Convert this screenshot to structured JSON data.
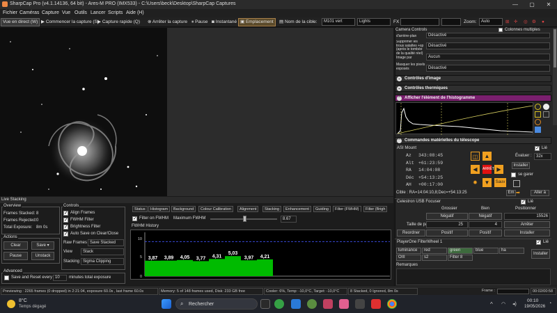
{
  "window": {
    "title": "SharpCap Pro (v4.1.14136, 64 bit) - Ares-M PRO (IMX533) - C:\\Users\\beck\\Desktop\\SharpCap Captures",
    "controls": [
      "—",
      "▢",
      "✕"
    ]
  },
  "menu": [
    "Fichier",
    "Caméras",
    "Capture",
    "Vue",
    "Outils",
    "Lancer",
    "Scripts",
    "Aide (H)"
  ],
  "toolbar": {
    "live_view": "Vue en direct (W)",
    "start_capture": "Commencer la capture (S)",
    "quick_capture": "Capture rapide (Q)",
    "stop_capture": "Arrêter la capture",
    "pause": "Pause",
    "snapshot": "Instantané",
    "placement": "Emplacement",
    "target_label": "Nom de la cible:",
    "target_value": "M101 vert",
    "frame_type": "Lights",
    "fx_label": "FX",
    "zoom_label": "Zoom:",
    "zoom_value": "Auto"
  },
  "live_stacking": {
    "title": "Live Stacking",
    "overview": {
      "label": "Overview",
      "frames_stacked_label": "Frames Stacked:",
      "frames_stacked": "8",
      "frames_rejected_label": "Frames Rejected:",
      "frames_rejected": "0",
      "total_exposure_label": "Total Exposure:",
      "total_exposure": "8m 0s"
    },
    "actions": {
      "label": "Actions",
      "clear": "Clear",
      "save": "Save",
      "pause": "Pause",
      "unstack": "Unstack"
    },
    "advanced": {
      "label": "Advanced",
      "save_reset_label": "Save and Reset every",
      "save_reset_value": "10",
      "minutes_label": "minutes total exposure"
    },
    "controls": {
      "label": "Controls",
      "align_frames": "Align Frames",
      "fwhm_filter": "FWHM Filter",
      "brightness_filter": "Brightness Filter",
      "auto_save": "Auto Save on Clear/Close",
      "raw_frames_label": "Raw Frames",
      "raw_frames_value": "Save Stacked",
      "view_label": "View",
      "view_value": "Stack",
      "stacking_label": "Stacking",
      "stacking_value": "Sigma Clipping"
    },
    "tabs": [
      "Status",
      "Histogram",
      "Background",
      "Colour Calibration",
      "Alignment",
      "Stacking",
      "Enhancement",
      "Guiding",
      "Filter (FWHM)",
      "Filter (Brigh"
    ],
    "fwhm": {
      "filter_label": "Filter on FWHM",
      "max_label": "Maximum FWHM",
      "max_value": "8.67",
      "history_label": "FWHM History",
      "axis_ticks": [
        "10",
        "5",
        "0"
      ]
    }
  },
  "chart_data": {
    "type": "bar",
    "title": "",
    "categories": [
      "1",
      "2",
      "3",
      "4",
      "5",
      "6",
      "7",
      "8"
    ],
    "values": [
      3.87,
      3.89,
      4.05,
      3.77,
      4.31,
      5.03,
      3.97,
      4.21
    ],
    "labels": [
      "3,87",
      "3,89",
      "4,05",
      "3,77",
      "4,31",
      "5,03",
      "3,97",
      "4,21"
    ],
    "threshold": 8.67,
    "ylim": [
      0,
      11
    ],
    "bar_color": "#00bb00",
    "threshold_color": "#3a4ad8"
  },
  "right_panel": {
    "camera_controls": {
      "title": "Camera Controls",
      "multi_columns": "Colonnes multiples",
      "rows": [
        {
          "label": "d'arrière-plan",
          "value": "Désactivé"
        },
        {
          "label": "Supprimer les trous sataltes +sp (après le tombée de la qualité réel)",
          "value": "Désactivé"
        },
        {
          "label": "Image par",
          "value": "Aucun"
        },
        {
          "label": "Masquer les pixels exposés",
          "value": "Désactivé"
        }
      ]
    },
    "sections": {
      "image_controls": "Contrôles d'image",
      "thermal_controls": "Contrôles thermiques",
      "histogram": "Afficher l'élément de l'histogramme",
      "telescope": "Commandes matérielles du télescope"
    },
    "mount": {
      "title": "ASI Mount",
      "az_label": "Az",
      "az": "343:08:45",
      "alt_label": "Alt",
      "alt": "+61:23:59",
      "ra_label": "RA",
      "ra": "14:04:08",
      "dec_label": "Déc",
      "dec": "+54:13:25",
      "ah_label": "AH",
      "ah": "+00:17:00",
      "cible": "Cible : RA=14:04:10,8;Dec=+54:13:25",
      "stop": "ARRÊT",
      "speed_label": "Évaluer :",
      "speed": "32x",
      "install": "Installer",
      "park_label": "se garer",
      "save": "Sauv",
      "go": "Aller à",
      "em": "Em",
      "lie": "Lié"
    },
    "focuser": {
      "title": "Celestron USB Focuser",
      "lie": "Lié",
      "col_coarse": "Grossier",
      "col_fine": "Bien",
      "col_pos": "Positionner",
      "negative": "Négatif",
      "position": "15526",
      "step_label": "Taille de pas",
      "step_coarse": "25",
      "step_fine": "4",
      "stop": "Arrêter",
      "reorder": "Reordner",
      "positive": "Positif",
      "install": "Installer"
    },
    "filterwheel": {
      "title": "PlayerOne FilterWheel 1",
      "lie": "Lié",
      "filters": [
        "luminance",
        "red",
        "green",
        "blue",
        "ha",
        "OIII",
        "s2",
        "Filter 8"
      ],
      "install": "Installer"
    },
    "remarks_label": "Remarques"
  },
  "statusbar": {
    "preview": "Previewing : 2265 frames (0 dropped) in 2:21:04, exposure 60.0s , last frame 60.0s",
    "memory": "Memory: 5 of 148 frames used, Disk: 233 GB free",
    "cooler": "Cooler: 6%, Temp: -10,0°C, Target: -10,0°C",
    "stacked": "8 Stacked, 0 Ignored, 8m 0s",
    "frame_label": "Frame :",
    "time": "00:02/00:58"
  },
  "taskbar": {
    "weather_temp": "8°C",
    "weather_text": "Temps dégagé",
    "search": "Rechercher",
    "clock_time": "00:10",
    "clock_date": "19/05/2026"
  }
}
